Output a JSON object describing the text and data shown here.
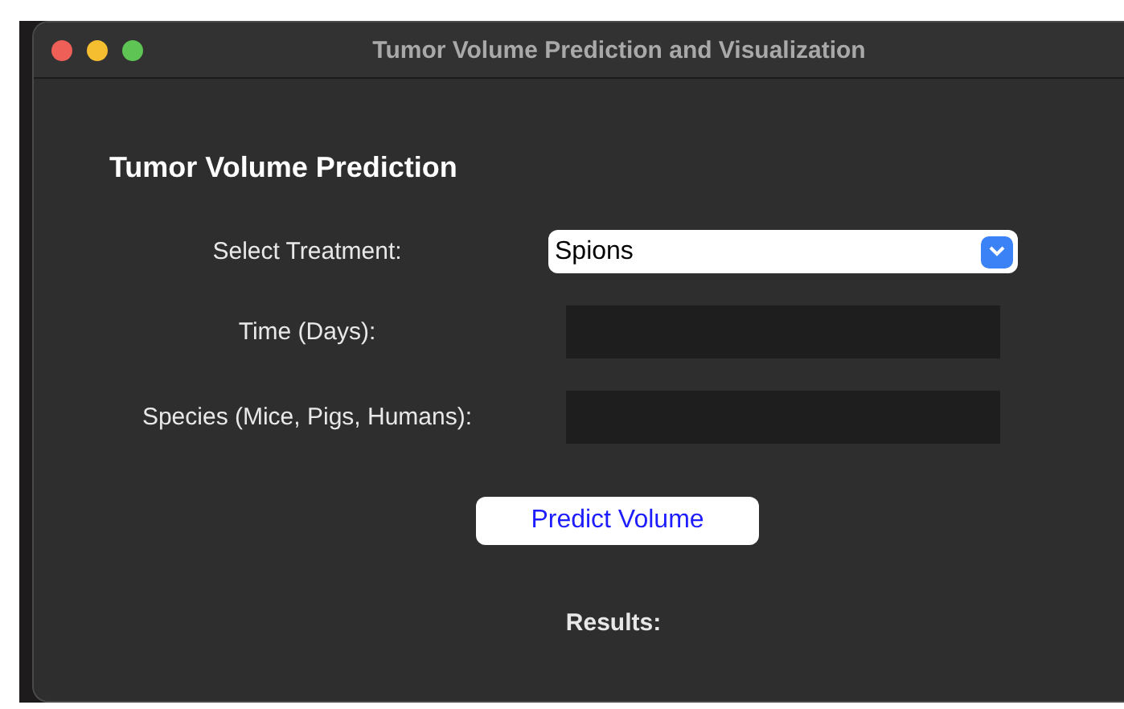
{
  "window": {
    "title": "Tumor Volume Prediction and Visualization"
  },
  "heading": "Tumor Volume Prediction",
  "fields": [
    {
      "label": "Select Treatment:",
      "kind": "select",
      "value": "Spions"
    },
    {
      "label": "Time (Days):",
      "kind": "text"
    },
    {
      "label": "Species (Mice, Pigs, Humans):",
      "kind": "text"
    }
  ],
  "button": "Predict Volume",
  "results_label": "Results:"
}
